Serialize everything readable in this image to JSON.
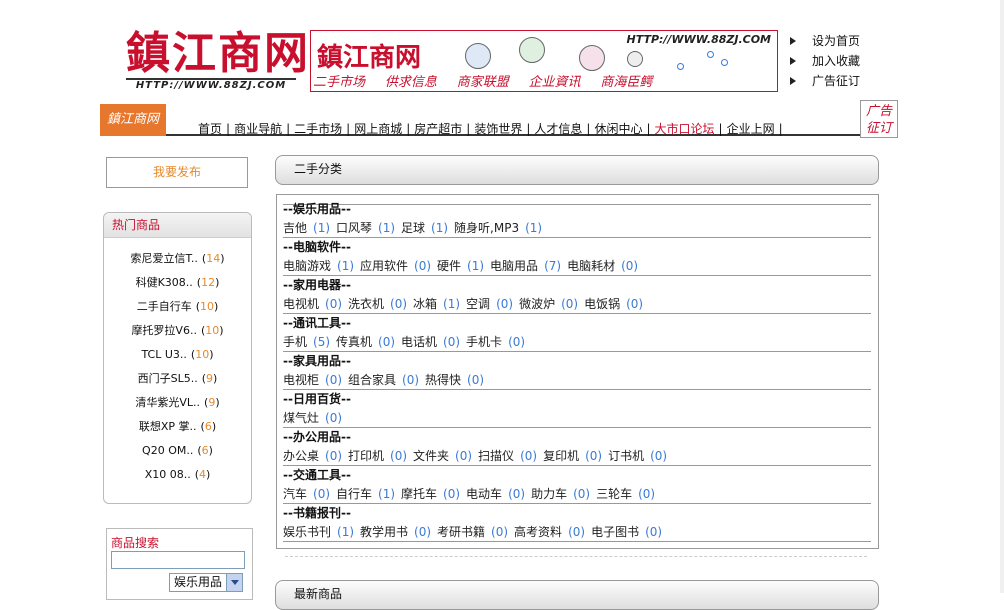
{
  "header": {
    "logo_text": "鎮江商网",
    "logo_url": "HTTP://WWW.88ZJ.COM",
    "banner": {
      "title": "鎮江商网",
      "url": "HTTP://WWW.88ZJ.COM",
      "tags": [
        "二手市场",
        "供求信息",
        "商家联盟",
        "企业資讯",
        "商海臣鳄"
      ]
    },
    "quick_links": [
      "设为首页",
      "加入收藏",
      "广告征订"
    ]
  },
  "nav": {
    "logo_text": "鎮江商网",
    "items": [
      {
        "label": "首页"
      },
      {
        "label": "商业导航"
      },
      {
        "label": "二手市场"
      },
      {
        "label": "网上商城"
      },
      {
        "label": "房产超市"
      },
      {
        "label": "装饰世界"
      },
      {
        "label": "人才信息"
      },
      {
        "label": "休闲中心"
      },
      {
        "label": "大市口论坛",
        "hot": true
      },
      {
        "label": "企业上网"
      }
    ],
    "ad_line1": "广告",
    "ad_line2": "征订"
  },
  "sidebar": {
    "post_button": "我要发布",
    "hot_title": "热门商品",
    "hot_items": [
      {
        "name": "索尼爱立信T..",
        "count": "14"
      },
      {
        "name": "科健K308..",
        "count": "12"
      },
      {
        "name": "二手自行车",
        "count": "10"
      },
      {
        "name": "摩托罗拉V6..",
        "count": "10"
      },
      {
        "name": "TCL U3..",
        "count": "10"
      },
      {
        "name": "西门子SL5..",
        "count": "9"
      },
      {
        "name": "清华紫光VL..",
        "count": "9"
      },
      {
        "name": "联想XP 掌..",
        "count": "6"
      },
      {
        "name": "Q20 OM..",
        "count": "6"
      },
      {
        "name": "X10 08..",
        "count": "4"
      }
    ],
    "search_title": "商品搜索",
    "search_value": "",
    "search_select": "娱乐用品"
  },
  "main": {
    "section_title": "二手分类",
    "latest_title": "最新商品",
    "categories": [
      {
        "title": "--娱乐用品--",
        "items": [
          {
            "name": "吉他",
            "count": "(1)"
          },
          {
            "name": "口风琴",
            "count": "(1)"
          },
          {
            "name": "足球",
            "count": "(1)"
          },
          {
            "name": "随身听,MP3",
            "count": "(1)"
          }
        ]
      },
      {
        "title": "--电脑软件--",
        "items": [
          {
            "name": "电脑游戏",
            "count": "(1)"
          },
          {
            "name": "应用软件",
            "count": "(0)"
          },
          {
            "name": "硬件",
            "count": "(1)"
          },
          {
            "name": "电脑用品",
            "count": "(7)"
          },
          {
            "name": "电脑耗材",
            "count": "(0)"
          }
        ]
      },
      {
        "title": "--家用电器--",
        "items": [
          {
            "name": "电视机",
            "count": "(0)"
          },
          {
            "name": "洗衣机",
            "count": "(0)"
          },
          {
            "name": "冰箱",
            "count": "(1)"
          },
          {
            "name": "空调",
            "count": "(0)"
          },
          {
            "name": "微波炉",
            "count": "(0)"
          },
          {
            "name": "电饭锅",
            "count": "(0)"
          }
        ]
      },
      {
        "title": "--通讯工具--",
        "items": [
          {
            "name": "手机",
            "count": "(5)"
          },
          {
            "name": "传真机",
            "count": "(0)"
          },
          {
            "name": "电话机",
            "count": "(0)"
          },
          {
            "name": "手机卡",
            "count": "(0)"
          }
        ]
      },
      {
        "title": "--家具用品--",
        "items": [
          {
            "name": "电视柜",
            "count": "(0)"
          },
          {
            "name": "组合家具",
            "count": "(0)"
          },
          {
            "name": "热得快",
            "count": "(0)"
          }
        ]
      },
      {
        "title": "--日用百货--",
        "items": [
          {
            "name": "煤气灶",
            "count": "(0)"
          }
        ]
      },
      {
        "title": "--办公用品--",
        "items": [
          {
            "name": "办公桌",
            "count": "(0)"
          },
          {
            "name": "打印机",
            "count": "(0)"
          },
          {
            "name": "文件夹",
            "count": "(0)"
          },
          {
            "name": "扫描仪",
            "count": "(0)"
          },
          {
            "name": "复印机",
            "count": "(0)"
          },
          {
            "name": "订书机",
            "count": "(0)"
          }
        ]
      },
      {
        "title": "--交通工具--",
        "items": [
          {
            "name": "汽车",
            "count": "(0)"
          },
          {
            "name": "自行车",
            "count": "(1)"
          },
          {
            "name": "摩托车",
            "count": "(0)"
          },
          {
            "name": "电动车",
            "count": "(0)"
          },
          {
            "name": "助力车",
            "count": "(0)"
          },
          {
            "name": "三轮车",
            "count": "(0)"
          }
        ]
      },
      {
        "title": "--书籍报刊--",
        "items": [
          {
            "name": "娱乐书刊",
            "count": "(1)"
          },
          {
            "name": "教学用书",
            "count": "(0)"
          },
          {
            "name": "考研书籍",
            "count": "(0)"
          },
          {
            "name": "高考资料",
            "count": "(0)"
          },
          {
            "name": "电子图书",
            "count": "(0)"
          }
        ]
      }
    ]
  }
}
